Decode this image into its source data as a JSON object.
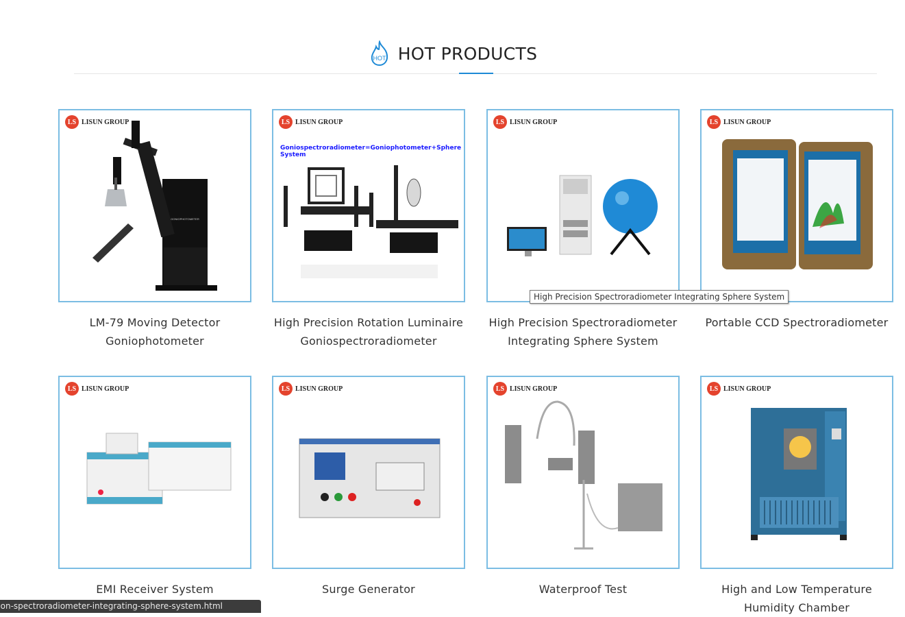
{
  "section": {
    "title": "HOT PRODUCTS",
    "icon_text": "HOT"
  },
  "brand": "LISUN GROUP",
  "products": [
    {
      "name": "LM-79 Moving Detector Goniophotometer",
      "banner": ""
    },
    {
      "name": "High Precision Rotation Luminaire Goniospectroradiometer",
      "banner": "Goniospectroradiometer=Goniophotometer+Sphere System"
    },
    {
      "name": "High Precision Spectroradiometer Integrating Sphere System",
      "banner": ""
    },
    {
      "name": "Portable CCD Spectroradiometer",
      "banner": ""
    },
    {
      "name": "EMI Receiver System",
      "banner": ""
    },
    {
      "name": "Surge Generator",
      "banner": ""
    },
    {
      "name": "Waterproof Test",
      "banner": ""
    },
    {
      "name": "High and Low Temperature Humidity Chamber",
      "banner": ""
    }
  ],
  "tooltip": "High Precision Spectroradiometer Integrating Sphere System",
  "status_url": "ision-spectroradiometer-integrating-sphere-system.html",
  "colors": {
    "accent": "#1e8ad6",
    "card_border": "#7bbde3",
    "brand_red": "#e4432d"
  }
}
